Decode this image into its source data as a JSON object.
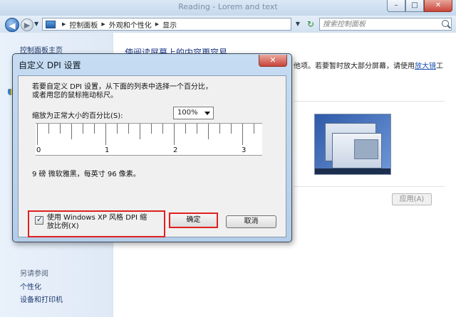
{
  "window": {
    "title": "Reading - Lorem and text",
    "caption_min": "–",
    "caption_max": "□",
    "caption_close": "✕"
  },
  "addressbar": {
    "back_glyph": "◀",
    "forward_glyph": "▶",
    "dropdown_glyph": "▼",
    "crumbs": [
      "控制面板",
      "外观和个性化",
      "显示"
    ],
    "crumb_sep": "▶",
    "refresh_glyph": "↻",
    "search_placeholder": "搜索控制面板"
  },
  "sidebar": {
    "home_link": "控制面板主页",
    "see_also": "另请参阅",
    "links": [
      "个性化",
      "设备和打印机"
    ]
  },
  "main": {
    "heading": "使阅读屏幕上的内容更容易",
    "desc_text": "他项。若要暂时放大部分屏幕，请使用",
    "desc_link": "放大镜",
    "desc_tail": "工",
    "apply_label": "应用(A)"
  },
  "dialog": {
    "title": "自定义 DPI 设置",
    "close_glyph": "✕",
    "instruction_line1": "若要自定义 DPI 设置，从下面的列表中选择一个百分比，",
    "instruction_line2": "或者用您的鼠标拖动标尺。",
    "scale_label": "缩放为正常大小的百分比(S):",
    "scale_value": "100%",
    "ruler_labels": [
      "0",
      "1",
      "2",
      "3"
    ],
    "font_info": "9 磅 微软雅黑，每英寸 96 像素。",
    "xp_checkbox_checked": true,
    "xp_label_line1": "使用 Windows XP 风格 DPI 缩",
    "xp_label_line2": "放比例(X)",
    "ok_label": "确定",
    "cancel_label": "取消"
  }
}
